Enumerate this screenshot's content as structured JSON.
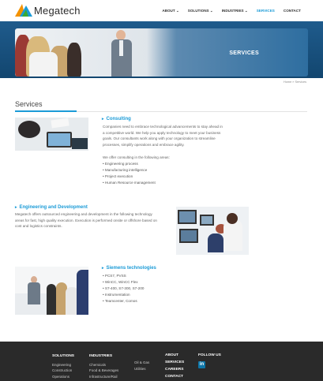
{
  "header": {
    "brand": "Megatech",
    "logo_icon": "megatech-triangle-logo",
    "nav": [
      "ABOUT",
      "SOLUTIONS",
      "INDUSTRIES",
      "SERVICES",
      "CONTACT"
    ],
    "nav_carets": [
      "⌄",
      "⌄",
      "⌄"
    ],
    "active_nav": "SERVICES"
  },
  "banner": {
    "title": "SERVICES"
  },
  "breadcrumb": {
    "home": "Home",
    "separator": "»",
    "current": "Services"
  },
  "page": {
    "title": "Services"
  },
  "consulting": {
    "title": "Consulting",
    "text": "Companies need to embrace technological advancements to stay ahead in a competitive world. We help you apply technology to meet your business goals. Our consultants work along with your organization to streamline processes, simplify operations and embrace agility.",
    "intro": "We offer consulting in the following areas:",
    "items": [
      "Engineering process",
      "Manufacturing intelligence",
      "Project execution",
      "Human Resource management"
    ]
  },
  "engineering": {
    "title": "Engineering and Development",
    "text": "Megatech offers outsourced engineering and development in the following technology areas for fast, high quality execution. Execution is performed onsite or offshore based on cost and logistics constraints."
  },
  "siemens": {
    "title": "Siemens technologies",
    "items": [
      "PCS7, PVSS",
      "WinCC, WinCC Flex",
      "S7-400, S7-300, S7-200",
      "Instrumentation",
      "Teamcenter, Comos"
    ]
  },
  "footer": {
    "solutions": {
      "title": "SOLUTIONS",
      "items": [
        "Engineering",
        "Construction",
        "Operations"
      ]
    },
    "industries": {
      "title": "INDUSTRIES",
      "col1": [
        "Chemicals",
        "Food & Beverages",
        "Infrastructure/Rail"
      ],
      "col2": [
        "Oil & Gas",
        "Utilities"
      ]
    },
    "links": [
      "ABOUT",
      "SERVICES",
      "CAREERS",
      "CONTACT"
    ],
    "follow": {
      "title": "FOLLOW US",
      "icon": "linkedin-icon",
      "icon_text": "in"
    }
  },
  "colors": {
    "accent": "#1b9bd7",
    "banner": "#1f5b8c",
    "footer": "#2a2a2a"
  }
}
